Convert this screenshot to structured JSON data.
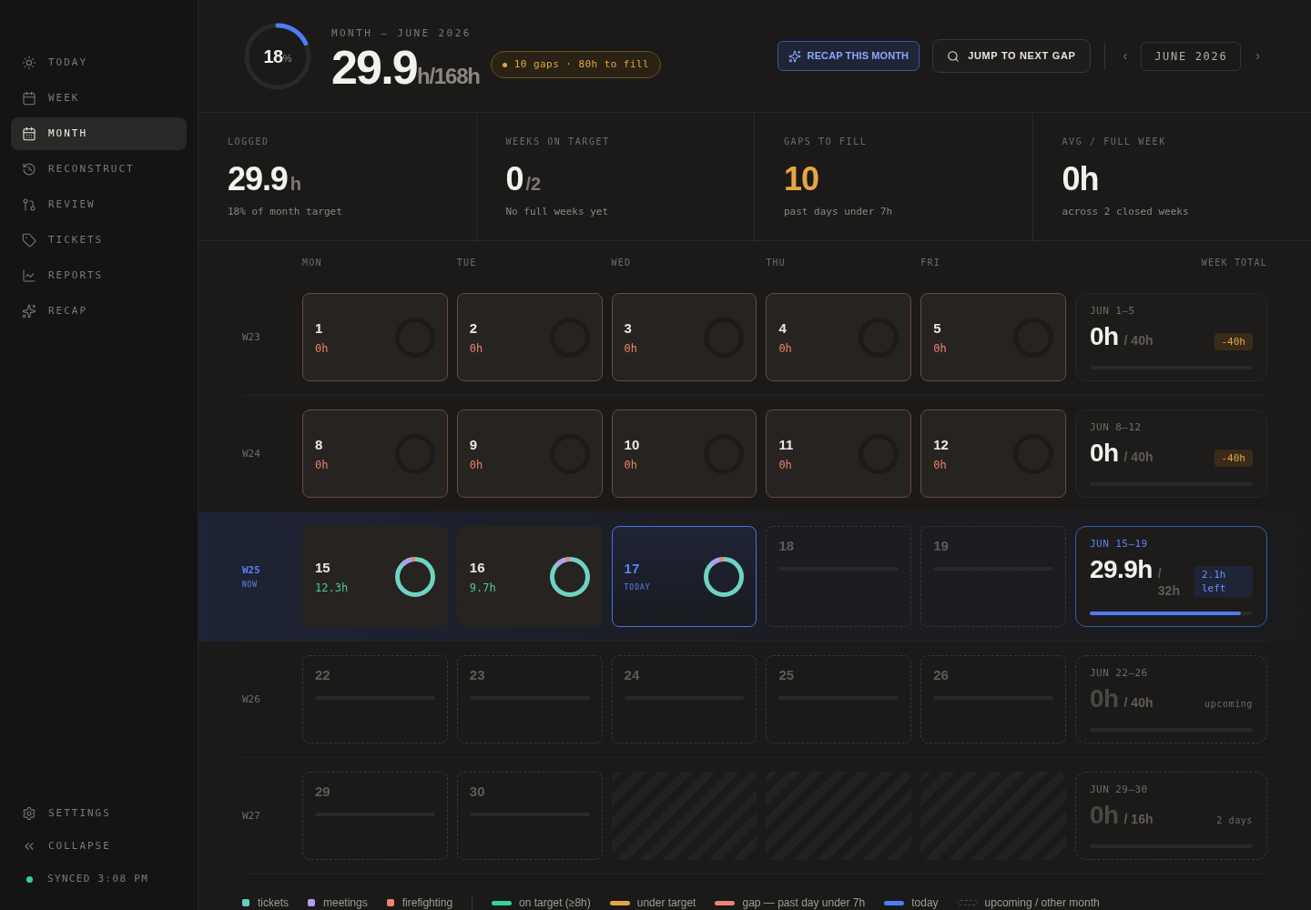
{
  "sidebar": {
    "items": [
      {
        "label": "TODAY",
        "selected": false
      },
      {
        "label": "WEEK",
        "selected": false
      },
      {
        "label": "MONTH",
        "selected": true
      },
      {
        "label": "RECONSTRUCT",
        "selected": false
      },
      {
        "label": "REVIEW",
        "selected": false
      },
      {
        "label": "TICKETS",
        "selected": false
      },
      {
        "label": "REPORTS",
        "selected": false
      },
      {
        "label": "RECAP",
        "selected": false
      }
    ],
    "footer": [
      {
        "label": "SETTINGS"
      },
      {
        "label": "COLLAPSE"
      }
    ],
    "sync": "SYNCED 3:08 PM"
  },
  "header": {
    "ring": {
      "value": "18",
      "unit": "%",
      "level": 0.18
    },
    "eyebrow": "MONTH — JUNE 2026",
    "total": "29.9",
    "target": "h/168h",
    "badge": "10 gaps · 80h to fill",
    "buttons": [
      {
        "label": "RECAP THIS MONTH",
        "kind": "accent"
      },
      {
        "label": "JUMP TO NEXT GAP",
        "kind": "outline"
      }
    ],
    "month_nav": {
      "prev": "‹",
      "label": "JUNE 2026",
      "next": "›"
    }
  },
  "stats": [
    {
      "label": "LOGGED",
      "value": "29.9",
      "unit": "h",
      "note": "18% of month target",
      "kind": "plain"
    },
    {
      "label": "WEEKS ON TARGET",
      "value": "0",
      "unit": "/2",
      "note": "No full weeks yet",
      "kind": "plain"
    },
    {
      "label": "GAPS TO FILL",
      "value": "10",
      "note": "past days under 7h",
      "kind": "warning"
    },
    {
      "label": "AVG / FULL WEEK",
      "value": "0h",
      "note": "across 2 closed weeks",
      "kind": "plain"
    }
  ],
  "calendar": {
    "columns": [
      "MON",
      "TUE",
      "WED",
      "THU",
      "FRI",
      "WEEK TOTAL"
    ],
    "weeks": [
      {
        "label": "W23",
        "current": false,
        "days": [
          {
            "kind": "gap",
            "day": "1",
            "hours": "0h"
          },
          {
            "kind": "gap",
            "day": "2",
            "hours": "0h"
          },
          {
            "kind": "gap",
            "day": "3",
            "hours": "0h"
          },
          {
            "kind": "gap",
            "day": "4",
            "hours": "0h"
          },
          {
            "kind": "gap",
            "day": "5",
            "hours": "0h"
          }
        ],
        "total": {
          "kind": "behind",
          "range": "JUN 1–5",
          "hours": "0h",
          "target": "/ 40h",
          "badge": "-40h"
        }
      },
      {
        "label": "W24",
        "current": false,
        "days": [
          {
            "kind": "gap",
            "day": "8",
            "hours": "0h"
          },
          {
            "kind": "gap",
            "day": "9",
            "hours": "0h"
          },
          {
            "kind": "gap",
            "day": "10",
            "hours": "0h"
          },
          {
            "kind": "gap",
            "day": "11",
            "hours": "0h"
          },
          {
            "kind": "gap",
            "day": "12",
            "hours": "0h"
          }
        ],
        "total": {
          "kind": "behind",
          "range": "JUN 8–12",
          "hours": "0h",
          "target": "/ 40h",
          "badge": "-40h"
        }
      },
      {
        "label": "W25",
        "sub": "NOW",
        "current": true,
        "days": [
          {
            "kind": "logged",
            "day": "15",
            "hours": "12.3h"
          },
          {
            "kind": "logged",
            "day": "16",
            "hours": "9.7h"
          },
          {
            "kind": "today",
            "day": "17",
            "note": "TODAY"
          },
          {
            "kind": "upcoming",
            "day": "18"
          },
          {
            "kind": "upcoming",
            "day": "19"
          }
        ],
        "total": {
          "kind": "current",
          "range": "JUN 15–19",
          "hours": "29.9h",
          "target": "/ 32h",
          "badge": "2.1h left",
          "level": 0.93
        }
      },
      {
        "label": "W26",
        "current": false,
        "days": [
          {
            "kind": "upcoming",
            "day": "22"
          },
          {
            "kind": "upcoming",
            "day": "23"
          },
          {
            "kind": "upcoming",
            "day": "24"
          },
          {
            "kind": "upcoming",
            "day": "25"
          },
          {
            "kind": "upcoming",
            "day": "26"
          }
        ],
        "total": {
          "kind": "upcoming",
          "range": "JUN 22–26",
          "hours": "0h",
          "target": "/ 40h",
          "note": "upcoming"
        }
      },
      {
        "label": "W27",
        "current": false,
        "days": [
          {
            "kind": "upcoming",
            "day": "29"
          },
          {
            "kind": "upcoming",
            "day": "30"
          },
          {
            "kind": "outside"
          },
          {
            "kind": "outside"
          },
          {
            "kind": "outside"
          }
        ],
        "total": {
          "kind": "upcoming",
          "range": "JUN 29–30",
          "hours": "0h",
          "target": "/ 16h",
          "note": "2 days"
        }
      }
    ]
  },
  "legend": {
    "categories": [
      {
        "label": "tickets",
        "color": "#5fcfbf"
      },
      {
        "label": "meetings",
        "color": "#b39cf0"
      },
      {
        "label": "firefighting",
        "color": "#e8856d"
      }
    ],
    "states": [
      {
        "label": "on target (≥8h)",
        "kind": "pill",
        "color": "#34d399"
      },
      {
        "label": "under target",
        "kind": "pill",
        "color": "#e5a642"
      },
      {
        "label": "gap — past day under 7h",
        "kind": "pill",
        "color": "#e8876f"
      },
      {
        "label": "today",
        "kind": "pill",
        "color": "#4f7cf7"
      },
      {
        "label": "upcoming / other month",
        "kind": "dashed"
      }
    ]
  }
}
